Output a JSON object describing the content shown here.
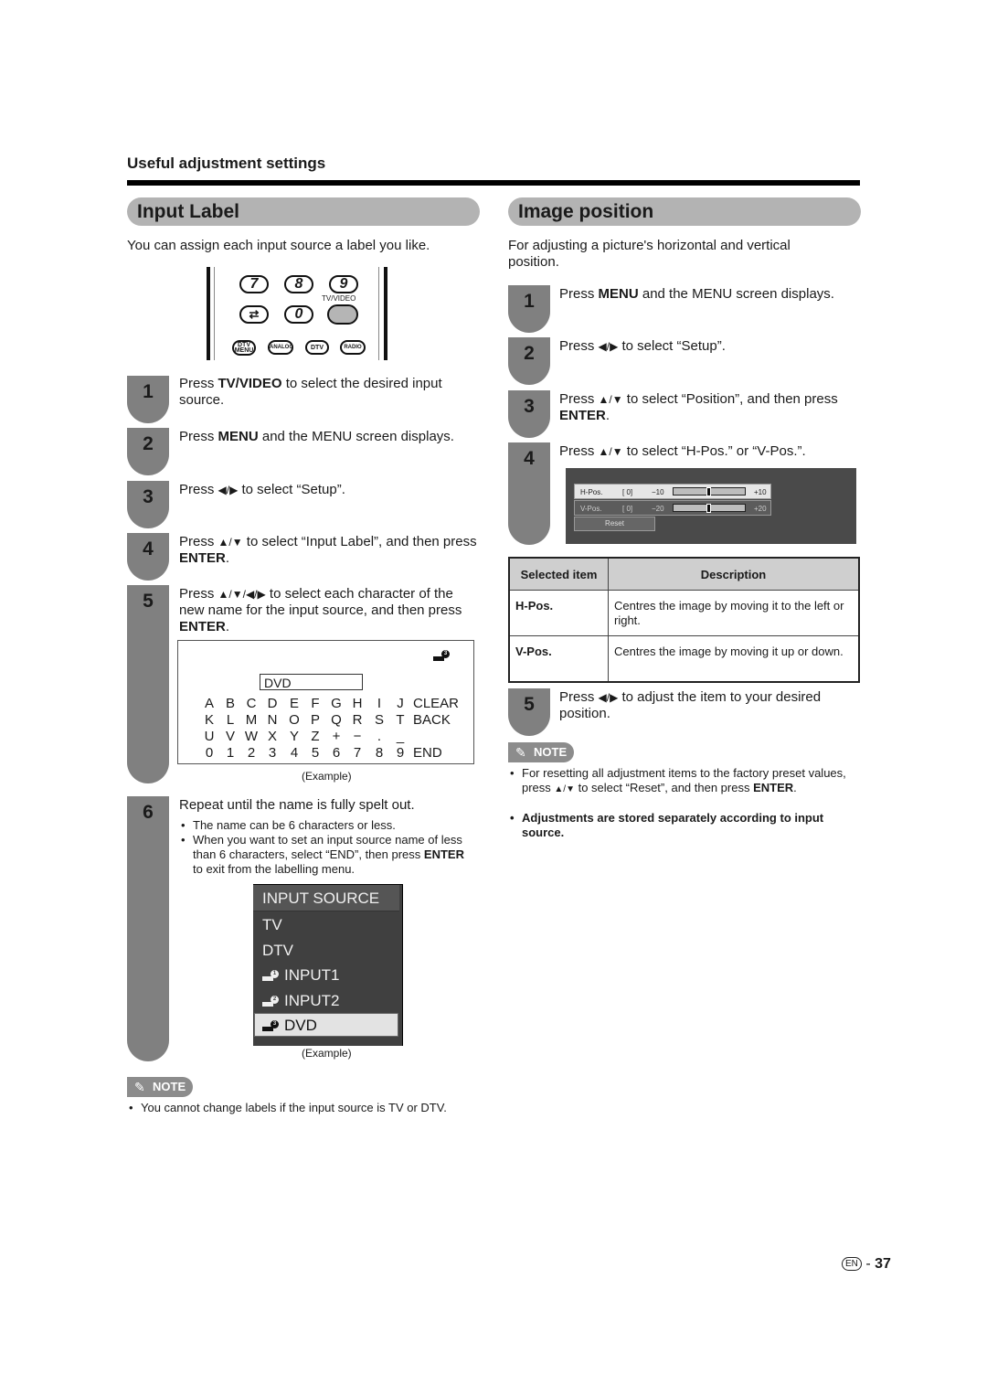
{
  "page": {
    "section_label": "Useful adjustment settings",
    "page_number": "37",
    "language_badge": "EN",
    "page_separator": "-"
  },
  "input_label": {
    "title": "Input Label",
    "intro": "You can assign each input source a label you like.",
    "remote": {
      "buttons": [
        "7",
        "8",
        "9",
        "⇄",
        "0"
      ],
      "tv_video_label": "TV/VIDEO",
      "small_buttons": [
        "DTV MENU",
        "ANALOG",
        "DTV",
        "RADIO"
      ]
    },
    "steps": [
      {
        "num": "1",
        "pre": "Press ",
        "bold": "TV/VIDEO",
        "post": " to select the desired input source."
      },
      {
        "num": "2",
        "pre": "Press ",
        "bold": "MENU",
        "post": " and the MENU screen displays."
      },
      {
        "num": "3",
        "pre": "Press ",
        "arrows": "◀/▶",
        "post": " to select “Setup”."
      },
      {
        "num": "4",
        "pre": "Press ",
        "arrows": "▲/▼",
        "post": " to select “Input Label”, and then press ",
        "bold_end": "ENTER",
        "end": "."
      },
      {
        "num": "5",
        "pre": "Press ",
        "arrows": "▲/▼/◀/▶",
        "post": " to select each character of the new name for the input source, and then press ",
        "bold_end": "ENTER",
        "end": "."
      },
      {
        "num": "6",
        "text": "Repeat until the name is fully spelt out."
      }
    ],
    "char_screen": {
      "source_num": "3",
      "name_value": "DVD",
      "rows": [
        [
          "A",
          "B",
          "C",
          "D",
          "E",
          "F",
          "G",
          "H",
          "I",
          "J",
          "CLEAR"
        ],
        [
          "K",
          "L",
          "M",
          "N",
          "O",
          "P",
          "Q",
          "R",
          "S",
          "T",
          "BACK"
        ],
        [
          "U",
          "V",
          "W",
          "X",
          "Y",
          "Z",
          "+",
          "−",
          ".",
          "_",
          ""
        ],
        [
          "0",
          "1",
          "2",
          "3",
          "4",
          "5",
          "6",
          "7",
          "8",
          "9",
          "END"
        ]
      ],
      "caption": "(Example)"
    },
    "step6_bullets": [
      "The name can be 6 characters or less.",
      "When you want to set an input source name of less than 6 characters, select “END”, then press"
    ],
    "step6_bullet2_bold": "ENTER",
    "step6_bullet2_end": " to exit from the labelling menu.",
    "source_menu": {
      "header": "INPUT SOURCE",
      "items": [
        {
          "label": "TV",
          "icon": ""
        },
        {
          "label": "DTV",
          "icon": ""
        },
        {
          "label": "INPUT1",
          "icon": "1"
        },
        {
          "label": "INPUT2",
          "icon": "2"
        },
        {
          "label": "DVD",
          "icon": "3",
          "selected": true
        }
      ],
      "caption": "(Example)"
    },
    "note": {
      "badge": "NOTE",
      "items": [
        "You cannot change labels if the input source is TV or DTV."
      ]
    }
  },
  "image_position": {
    "title": "Image position",
    "intro": "For adjusting a picture's horizontal and vertical position.",
    "steps": [
      {
        "num": "1",
        "pre": "Press ",
        "bold": "MENU",
        "post": " and the MENU screen displays."
      },
      {
        "num": "2",
        "pre": "Press ",
        "arrows": "◀/▶",
        "post": " to select “Setup”."
      },
      {
        "num": "3",
        "pre": "Press ",
        "arrows": "▲/▼",
        "post": " to select “Position”, and then press ",
        "bold_end": "ENTER",
        "end": "."
      },
      {
        "num": "4",
        "pre": "Press ",
        "arrows": "▲/▼",
        "post": " to select “H-Pos.” or “V-Pos.”."
      },
      {
        "num": "5",
        "pre": "Press ",
        "arrows": "◀/▶",
        "post": " to adjust the item to your desired position."
      }
    ],
    "osd": {
      "rows": [
        {
          "label": "H-Pos.",
          "value": "[  0]",
          "min": "−10",
          "max": "+10",
          "position": 0.5
        },
        {
          "label": "V-Pos.",
          "value": "[  0]",
          "min": "−20",
          "max": "+20",
          "position": 0.5
        }
      ],
      "reset_label": "Reset"
    },
    "table": {
      "headers": [
        "Selected item",
        "Description"
      ],
      "rows": [
        [
          "H-Pos.",
          "Centres the image by moving it to the left or right."
        ],
        [
          "V-Pos.",
          "Centres the image by moving it up or down."
        ]
      ]
    },
    "note": {
      "badge": "NOTE",
      "item1_pre": "For resetting all adjustment items to the factory preset values, press ",
      "item1_arrows": "▲/▼",
      "item1_post": " to select “Reset”, and then press ",
      "item1_bold": "ENTER",
      "item1_end": ".",
      "item2": "Adjustments are stored separately according to input source."
    }
  }
}
